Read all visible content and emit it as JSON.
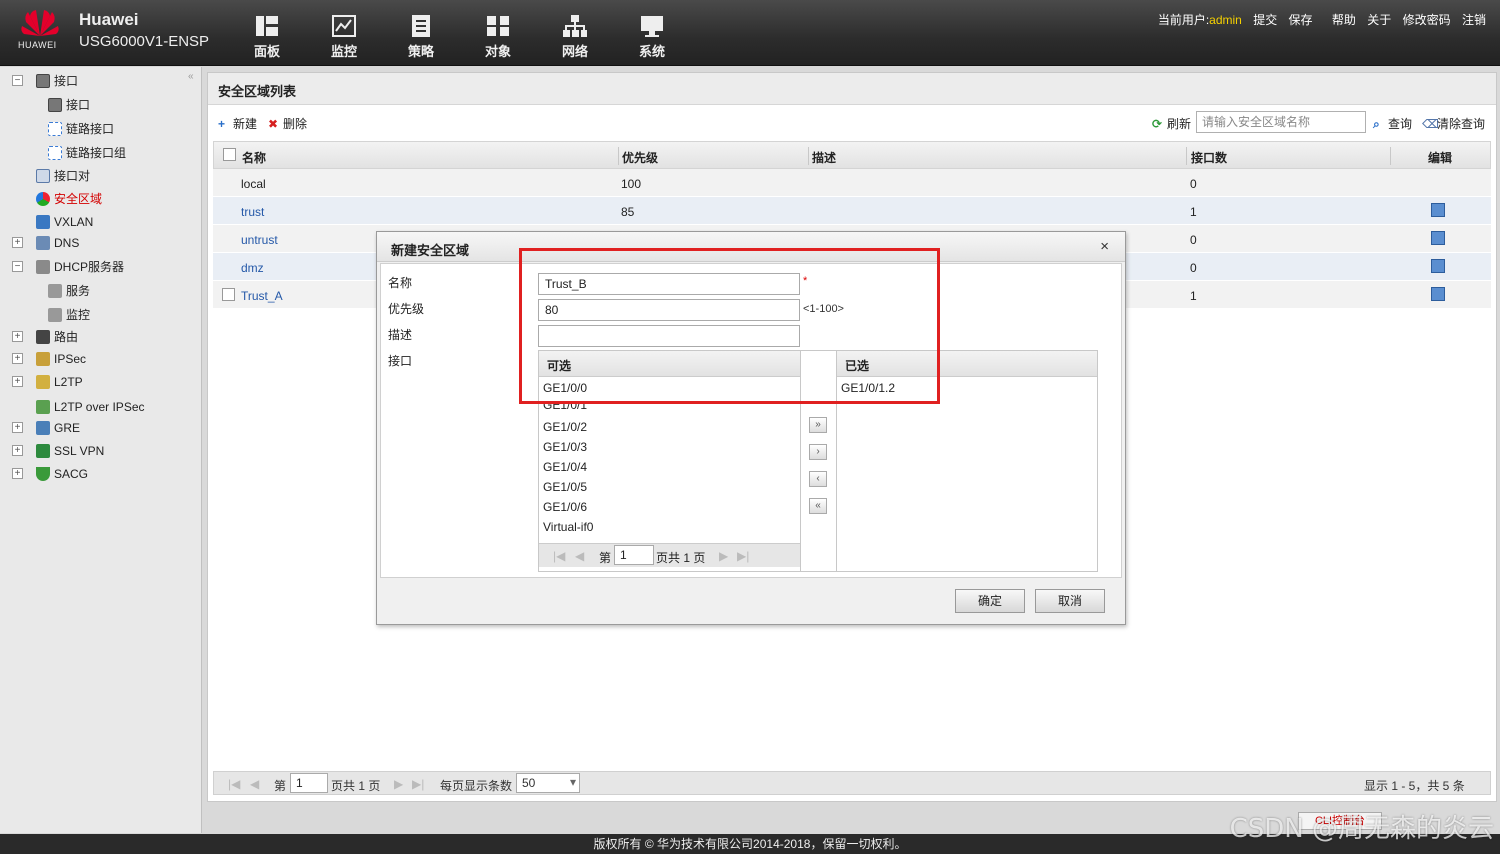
{
  "header": {
    "logo_text": "HUAWEI",
    "brand": "Huawei",
    "model": "USG6000V1-ENSP",
    "nav": [
      "面板",
      "监控",
      "策略",
      "对象",
      "网络",
      "系统"
    ],
    "current_user_label": "当前用户:",
    "username": "admin",
    "links": [
      "提交",
      "保存",
      "帮助",
      "关于",
      "修改密码",
      "注销"
    ]
  },
  "sidebar": {
    "collapse": "«",
    "items": [
      {
        "label": "接口",
        "icon": "interface-icon"
      },
      {
        "label": "接口",
        "icon": "interface-icon"
      },
      {
        "label": "链路接口",
        "icon": "link-interface-icon"
      },
      {
        "label": "链路接口组",
        "icon": "link-interface-group-icon"
      },
      {
        "label": "接口对",
        "icon": "interface-pair-icon"
      },
      {
        "label": "安全区域",
        "icon": "security-zone-icon"
      },
      {
        "label": "VXLAN",
        "icon": "vxlan-icon"
      },
      {
        "label": "DNS",
        "icon": "dns-icon"
      },
      {
        "label": "DHCP服务器",
        "icon": "dhcp-icon"
      },
      {
        "label": "服务",
        "icon": "service-icon"
      },
      {
        "label": "监控",
        "icon": "monitor-icon"
      },
      {
        "label": "路由",
        "icon": "route-icon"
      },
      {
        "label": "IPSec",
        "icon": "ipsec-icon"
      },
      {
        "label": "L2TP",
        "icon": "l2tp-icon"
      },
      {
        "label": "L2TP over IPSec",
        "icon": "l2tp-ipsec-icon"
      },
      {
        "label": "GRE",
        "icon": "gre-icon"
      },
      {
        "label": "SSL VPN",
        "icon": "ssl-vpn-icon"
      },
      {
        "label": "SACG",
        "icon": "sacg-icon"
      }
    ]
  },
  "main": {
    "title": "安全区域列表",
    "toolbar": {
      "new": "新建",
      "delete": "删除",
      "refresh": "刷新",
      "search_placeholder": "请输入安全区域名称",
      "query": "查询",
      "clear": "清除查询"
    },
    "columns": [
      "名称",
      "优先级",
      "描述",
      "接口数",
      "编辑"
    ],
    "rows": [
      {
        "name": "local",
        "priority": "100",
        "desc": "",
        "count": "0"
      },
      {
        "name": "trust",
        "priority": "85",
        "desc": "",
        "count": "1"
      },
      {
        "name": "untrust",
        "priority": "",
        "desc": "",
        "count": "0"
      },
      {
        "name": "dmz",
        "priority": "",
        "desc": "",
        "count": "0"
      },
      {
        "name": "Trust_A",
        "priority": "",
        "desc": "",
        "count": "1"
      }
    ],
    "pager": {
      "page_prefix": "第",
      "page": "1",
      "page_suffix": "页共 1 页",
      "per_page_label": "每页显示条数",
      "per_page": "50",
      "summary": "显示 1 - 5，共 5 条"
    }
  },
  "dialog": {
    "title": "新建安全区域",
    "close": "×",
    "name_label": "名称",
    "name_value": "Trust_B",
    "required_mark": "*",
    "priority_label": "优先级",
    "priority_value": "80",
    "priority_hint": "<1-100>",
    "desc_label": "描述",
    "desc_value": "",
    "interface_label": "接口",
    "available_header": "可选",
    "available": [
      "GE1/0/0",
      "GE1/0/1",
      "GE1/0/2",
      "GE1/0/3",
      "GE1/0/4",
      "GE1/0/5",
      "GE1/0/6",
      "Virtual-if0"
    ],
    "selected_header": "已选",
    "selected": [
      "GE1/0/1.2"
    ],
    "pager": {
      "prefix": "第",
      "page": "1",
      "suffix": "页共 1 页"
    },
    "move_buttons": [
      "»",
      "›",
      "‹",
      "«"
    ],
    "ok": "确定",
    "cancel": "取消"
  },
  "footer": {
    "copyright": "版权所有 © 华为技术有限公司2014-2018，保留一切权利。",
    "online_button": "CLI控制台",
    "watermark": "CSDN @周无森的炎云"
  },
  "colors": {
    "accent_red": "#d30000",
    "link_blue": "#2458a8",
    "highlight": "#e02020",
    "username": "#f5d000"
  }
}
